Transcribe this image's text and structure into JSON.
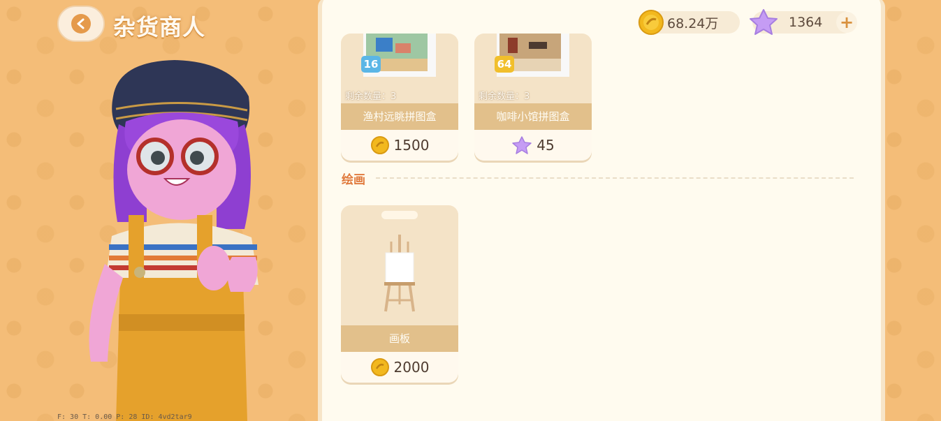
{
  "header": {
    "title": "杂货商人"
  },
  "currency": {
    "coins": "68.24万",
    "stars": "1364",
    "plus_label": "+"
  },
  "debug_text": "F: 30    T: 0.00    P: 28    ID: 4vd2tar9",
  "shop": {
    "puzzle_items": [
      {
        "name": "渔村远眺拼图盒",
        "remaining": "剩余数量：3",
        "level": "16",
        "level_color": "#5bb6e6",
        "price": "1500",
        "currency": "coin"
      },
      {
        "name": "咖啡小馆拼图盒",
        "remaining": "剩余数量：3",
        "level": "64",
        "level_color": "#f1bf2c",
        "price": "45",
        "currency": "star"
      }
    ],
    "painting_section": {
      "label": "绘画",
      "items": [
        {
          "name": "画板",
          "price": "2000",
          "currency": "coin"
        }
      ]
    }
  },
  "colors": {
    "accent_orange": "#e07a3d",
    "coin_gold": "#f2b81e",
    "star_purple": "#b98ef0",
    "panel_bg": "#fffbef"
  }
}
